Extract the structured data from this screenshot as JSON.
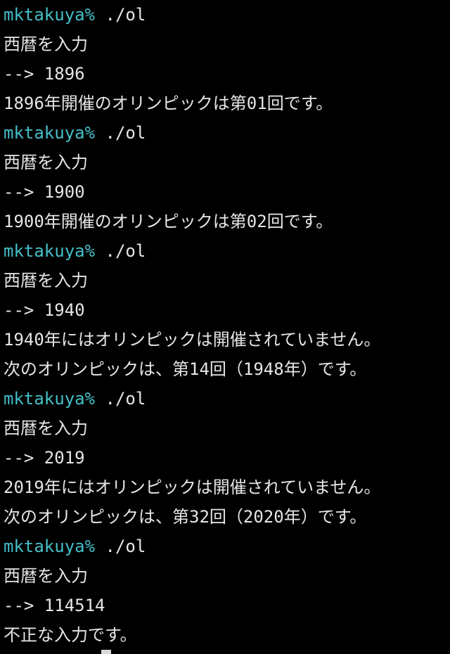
{
  "terminal": {
    "colors": {
      "background": "#000000",
      "foreground": "#e6e6e6",
      "prompt": "#45bfc8",
      "cursor": "#d9d9d9"
    },
    "lines": [
      {
        "kind": "prompt",
        "user": "mktakuya%",
        "command": " ./ol"
      },
      {
        "kind": "output",
        "text": "西暦を入力"
      },
      {
        "kind": "output",
        "text": "--> 1896"
      },
      {
        "kind": "output",
        "text": "1896年開催のオリンピックは第01回です。"
      },
      {
        "kind": "prompt",
        "user": "mktakuya%",
        "command": " ./ol"
      },
      {
        "kind": "output",
        "text": "西暦を入力"
      },
      {
        "kind": "output",
        "text": "--> 1900"
      },
      {
        "kind": "output",
        "text": "1900年開催のオリンピックは第02回です。"
      },
      {
        "kind": "prompt",
        "user": "mktakuya%",
        "command": " ./ol"
      },
      {
        "kind": "output",
        "text": "西暦を入力"
      },
      {
        "kind": "output",
        "text": "--> 1940"
      },
      {
        "kind": "output",
        "text": "1940年にはオリンピックは開催されていません。"
      },
      {
        "kind": "output",
        "text": "次のオリンピックは、第14回（1948年）です。"
      },
      {
        "kind": "prompt",
        "user": "mktakuya%",
        "command": " ./ol"
      },
      {
        "kind": "output",
        "text": "西暦を入力"
      },
      {
        "kind": "output",
        "text": "--> 2019"
      },
      {
        "kind": "output",
        "text": "2019年にはオリンピックは開催されていません。"
      },
      {
        "kind": "output",
        "text": "次のオリンピックは、第32回（2020年）です。"
      },
      {
        "kind": "prompt",
        "user": "mktakuya%",
        "command": " ./ol"
      },
      {
        "kind": "output",
        "text": "西暦を入力"
      },
      {
        "kind": "output",
        "text": "--> 114514"
      },
      {
        "kind": "output",
        "text": "不正な入力です。"
      }
    ]
  }
}
